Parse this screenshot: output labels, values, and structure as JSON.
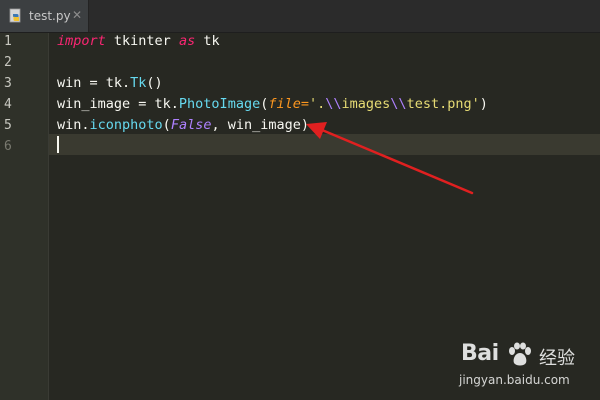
{
  "tab": {
    "filename": "test.py",
    "close_glyph": "✕",
    "icon": "python-file-icon"
  },
  "gutter": {
    "line_numbers": [
      "1",
      "2",
      "3",
      "4",
      "5",
      "6"
    ]
  },
  "code": {
    "line1": {
      "kw_import": "import",
      "module": " tkinter ",
      "kw_as": "as",
      "alias": " tk"
    },
    "line3": {
      "pre": "win = tk.",
      "call": "Tk",
      "post": "()"
    },
    "line4": {
      "pre": "win_image = tk.",
      "call": "PhotoImage",
      "open": "(",
      "param": "file=",
      "str1": "'.",
      "esc1": "\\\\",
      "str2": "images",
      "esc2": "\\\\",
      "str3": "test.png'",
      "close": ")"
    },
    "line5": {
      "pre": "win.",
      "call": "iconphoto",
      "open": "(",
      "falsy": "False",
      "post": ", win_image)"
    },
    "current_line": 6
  },
  "annotation": {
    "arrow_color": "#e02020",
    "icon": "red-arrow-annotation"
  },
  "watermark": {
    "brand": "Bai",
    "chinese": "经验",
    "url": "jingyan.baidu.com",
    "icon": "baidu-paw-icon"
  },
  "colors": {
    "background": "#272822",
    "keyword": "#f92672",
    "builtin": "#66d9ef",
    "string": "#e6db74",
    "escape": "#ae81ff",
    "param": "#fd971f"
  }
}
